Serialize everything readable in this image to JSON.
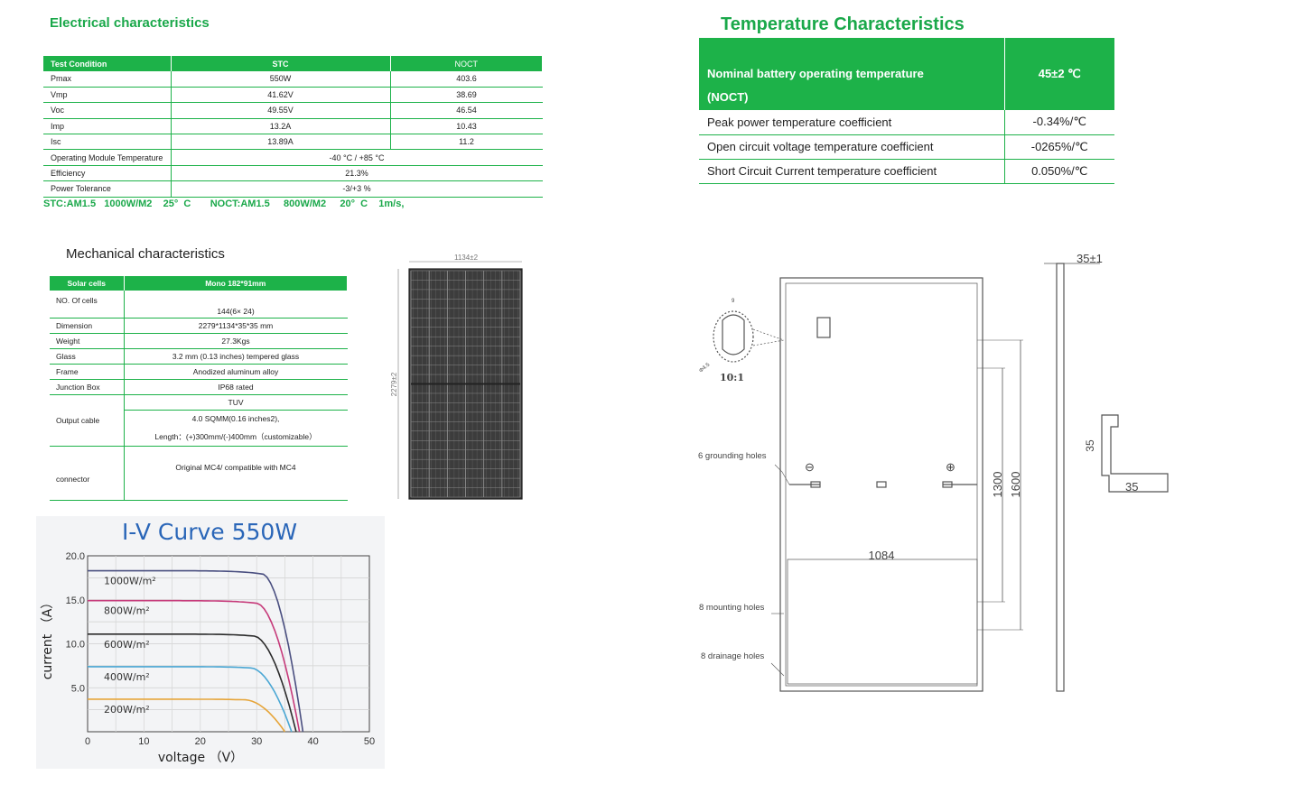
{
  "electrical": {
    "title": "Electrical characteristics",
    "headers": [
      "Test Condition",
      "STC",
      "NOCT"
    ],
    "rows": [
      [
        "Pmax",
        "550W",
        "403.6"
      ],
      [
        "Vmp",
        "41.62V",
        "38.69"
      ],
      [
        "Voc",
        "49.55V",
        "46.54"
      ],
      [
        "Imp",
        "13.2A",
        "10.43"
      ],
      [
        "Isc",
        "13.89A",
        "11.2"
      ]
    ],
    "merged_rows": [
      [
        "Operating Module Temperature",
        "-40 °C / +85 °C"
      ],
      [
        "Efficiency",
        "21.3%"
      ],
      [
        "Power Tolerance",
        "-3/+3 %"
      ]
    ],
    "note": "STC:AM1.5   1000W/M2    25°  C       NOCT:AM1.5     800W/M2     20°  C    1m/s,"
  },
  "temperature": {
    "title": "Temperature Characteristics",
    "header_label_line1": "Nominal battery operating temperature",
    "header_label_line2": "(NOCT)",
    "header_value": "45±2 ℃",
    "rows": [
      [
        "Peak power temperature coefficient",
        "-0.34%/℃"
      ],
      [
        "Open circuit voltage temperature coefficient",
        "-0265%/℃"
      ],
      [
        "Short Circuit Current temperature coefficient",
        "0.050%/℃"
      ]
    ]
  },
  "mechanical": {
    "title": "Mechanical characteristics",
    "headers": [
      "Solar cells",
      "Mono 182*91mm"
    ],
    "cells_label": "NO. Of cells",
    "cells_value": "144(6× 24)",
    "dimension_label": "Dimension",
    "dimension_value": "2279*1134*35*35 mm",
    "weight_label": "Weight",
    "weight_value": "27.3Kgs",
    "glass_label": "Glass",
    "glass_value": "3.2 mm (0.13 inches) tempered glass",
    "frame_label": "Frame",
    "frame_value": "Anodized aluminum alloy",
    "jbox_label": "Junction Box",
    "jbox_value": "IP68 rated",
    "cable_label": "Output cable",
    "cable_value1": "TUV",
    "cable_value2": "4.0 SQMM(0.16 inches2),",
    "cable_value3": "Length：(+)300mm/(-)400mm（customizable）",
    "connector_label": "connector",
    "connector_value": "Original MC4/ compatible with MC4"
  },
  "panel_drawing": {
    "width_label": "1134±2",
    "height_label": "2279±2"
  },
  "dimension_drawing": {
    "detail_scale": "10:1",
    "detail_small": "9",
    "detail_hole": "Φ4.5",
    "grounding_label": "6 grounding holes",
    "mounting_label": "8 mounting holes",
    "drainage_label": "8 drainage holes",
    "width_1084": "1084",
    "dim_1300": "1300",
    "dim_1600": "1600",
    "thickness": "35±1",
    "profile_h": "35",
    "profile_w": "35",
    "minus": "⊖",
    "plus": "⊕"
  },
  "chart_data": {
    "type": "line",
    "title": "I-V Curve 550W",
    "xlabel": "voltage （V）",
    "ylabel": "current （A）",
    "xlim": [
      0,
      50
    ],
    "ylim": [
      0,
      20
    ],
    "xticks": [
      "0",
      "10",
      "20",
      "30",
      "40",
      "50"
    ],
    "yticks": [
      "5.0",
      "10.0",
      "15.0",
      "20.0"
    ],
    "grid": true,
    "series": [
      {
        "name": "1000W/m²",
        "isc": 18.3,
        "voc": 38.2,
        "knee": 31,
        "color": "#4a4f80"
      },
      {
        "name": "800W/m²",
        "isc": 14.9,
        "voc": 37.6,
        "knee": 30,
        "color": "#c63a7a"
      },
      {
        "name": "600W/m²",
        "isc": 11.1,
        "voc": 37.0,
        "knee": 29.5,
        "color": "#2b2b2b"
      },
      {
        "name": "400W/m²",
        "isc": 7.4,
        "voc": 36.2,
        "knee": 29,
        "color": "#4aa7d4"
      },
      {
        "name": "200W/m²",
        "isc": 3.7,
        "voc": 35.0,
        "knee": 28,
        "color": "#e6a53a"
      }
    ]
  }
}
